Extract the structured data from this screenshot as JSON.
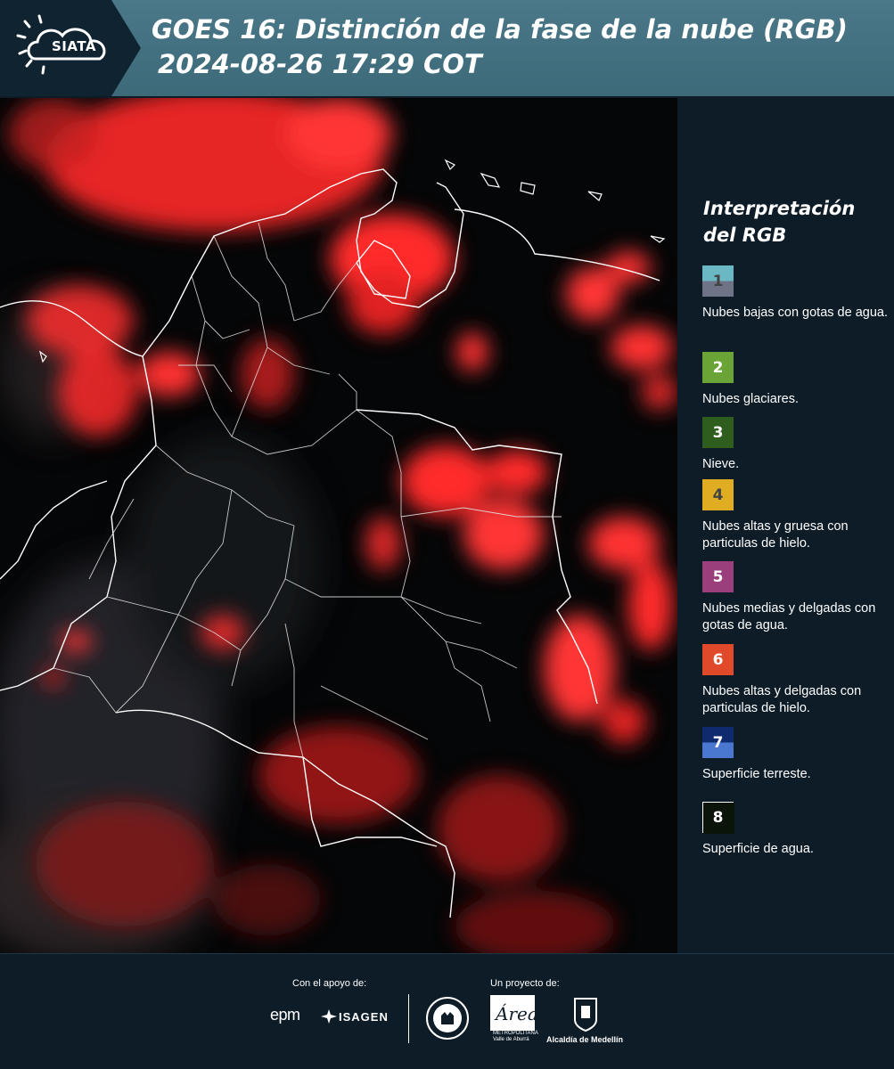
{
  "header": {
    "logo_text": "SIATA",
    "title_line1": "GOES 16: Distinción de la fase de la nube (RGB)",
    "title_line2": "2024-08-26 17:29 COT",
    "band_color": "#3f6d7c"
  },
  "map": {
    "background_color": "#050607",
    "cloud_color": "#ff2a2a",
    "border_color": "#ffffff"
  },
  "legend": {
    "title": "Interpretación del RGB",
    "items": [
      {
        "num": "1",
        "desc": "Nubes bajas con gotas de agua.",
        "color_top": "#6ab8c4",
        "color_bottom": "#6e7388",
        "num_color": "#444444"
      },
      {
        "num": "2",
        "desc": "Nubes glaciares.",
        "color_top": "#6aa437",
        "color_bottom": "#6aa437",
        "num_color": "#ffffff"
      },
      {
        "num": "3",
        "desc": "Nieve.",
        "color_top": "#2f5d1e",
        "color_bottom": "#2f5d1e",
        "num_color": "#ffffff"
      },
      {
        "num": "4",
        "desc": "Nubes altas y gruesa con particulas de hielo.",
        "color_top": "#e0ac22",
        "color_bottom": "#e0ac22",
        "num_color": "#444444"
      },
      {
        "num": "5",
        "desc": "Nubes medias y delgadas con gotas de agua.",
        "color_top": "#9a3f7c",
        "color_bottom": "#9a3f7c",
        "num_color": "#ffffff"
      },
      {
        "num": "6",
        "desc": "Nubes altas y delgadas con particulas de hielo.",
        "color_top": "#e04a2a",
        "color_bottom": "#e04a2a",
        "num_color": "#ffffff"
      },
      {
        "num": "7",
        "desc": "Superficie terreste.",
        "color_top": "#0f2a6e",
        "color_bottom": "#4a78d0",
        "num_color": "#ffffff"
      },
      {
        "num": "8",
        "desc": "Superficie de agua.",
        "color_top": "#0a1408",
        "color_bottom": "#0a1408",
        "num_color": "#ffffff"
      }
    ]
  },
  "footer": {
    "support_label": "Con el apoyo de:",
    "project_label": "Un proyecto de:",
    "epm_text": "epm",
    "isagen_text": "ISAGEN",
    "area_logo_text": "Área",
    "area_caption": "METROPOLITANA Valle de Aburrá",
    "alcaldia_text": "Alcaldía de Medellín"
  }
}
